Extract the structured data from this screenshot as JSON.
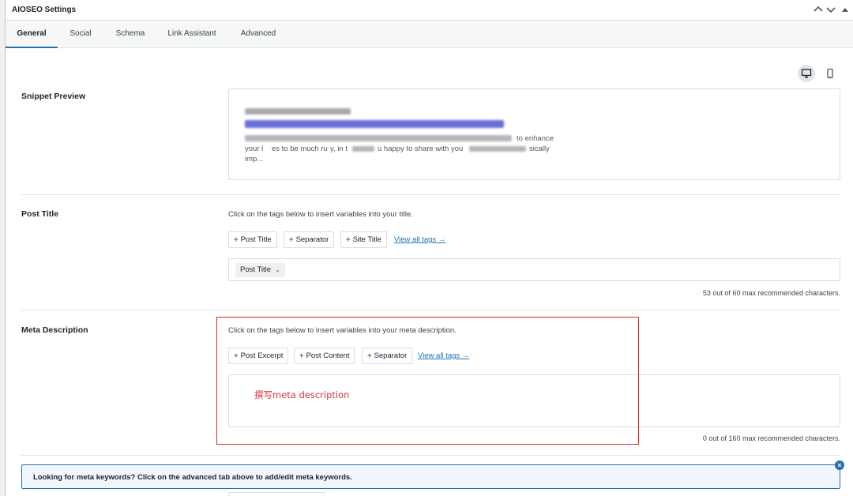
{
  "header": {
    "title": "AIOSEO Settings",
    "icons": [
      "chevron-up-icon",
      "chevron-down-icon",
      "triangle-up-icon"
    ]
  },
  "tabs": [
    {
      "label": "General",
      "active": true
    },
    {
      "label": "Social",
      "active": false
    },
    {
      "label": "Schema",
      "active": false
    },
    {
      "label": "Link Assistant",
      "active": false
    },
    {
      "label": "Advanced",
      "active": false
    }
  ],
  "preview_devices": [
    {
      "icon": "desktop-icon",
      "active": true
    },
    {
      "icon": "mobile-icon",
      "active": false
    }
  ],
  "snippet_preview": {
    "label": "Snippet Preview",
    "description_line1": "to enhance",
    "description_line2_a": "your l",
    "description_line2_b": "es to be much ru",
    "description_line2_c": "y, in t",
    "description_line2_d": "u happy to share with you",
    "description_line2_e": "sically",
    "description_line3": "imp..."
  },
  "post_title": {
    "label": "Post Title",
    "help": "Click on the tags below to insert variables into your title.",
    "tags": [
      "Post Title",
      "Separator",
      "Site Title"
    ],
    "view_all": "View all tags →",
    "chip": "Post Title",
    "char_count": "53 out of 60 max recommended characters."
  },
  "meta_description": {
    "label": "Meta Description",
    "help": "Click on the tags below to insert variables into your meta description.",
    "tags": [
      "Post Excerpt",
      "Post Content",
      "Separator"
    ],
    "view_all": "View all tags →",
    "annotation": "撰写meta description",
    "char_count": "0 out of 160 max recommended characters."
  },
  "notice": {
    "text": "Looking for meta keywords? Click on the advanced tab above to add/edit meta keywords."
  },
  "colors": {
    "accent": "#2271b1",
    "highlight": "#e02424",
    "annotation": "#d63638"
  }
}
